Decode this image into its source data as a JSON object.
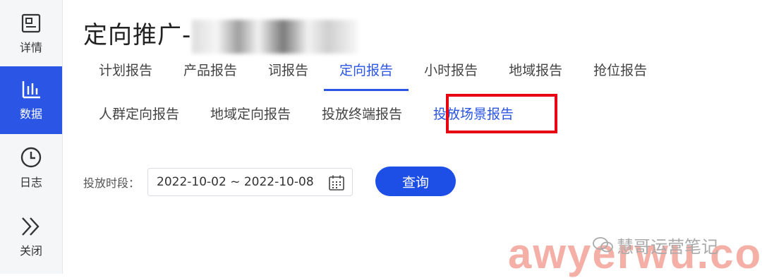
{
  "sidebar": {
    "items": [
      {
        "label": "详情",
        "icon": "detail-card-icon"
      },
      {
        "label": "数据",
        "icon": "bar-chart-icon",
        "active": true
      },
      {
        "label": "日志",
        "icon": "clock-icon"
      },
      {
        "label": "关闭",
        "icon": "double-chevron-right-icon"
      }
    ]
  },
  "header": {
    "title": "定向推广-"
  },
  "tabs_primary": [
    "计划报告",
    "产品报告",
    "词报告",
    "定向报告",
    "小时报告",
    "地域报告",
    "抢位报告"
  ],
  "tabs_secondary": [
    "人群定向报告",
    "地域定向报告",
    "投放终端报告",
    "投放场景报告"
  ],
  "filter": {
    "date_label": "投放时段：",
    "date_range": "2022-10-02 ~ 2022-10-08",
    "query_label": "查询"
  },
  "watermark": {
    "wechat_text": "慧哥运营笔记",
    "site_text": "awyerwu.com"
  },
  "colors": {
    "accent": "#2a55e5",
    "highlight_border": "#e60012"
  }
}
